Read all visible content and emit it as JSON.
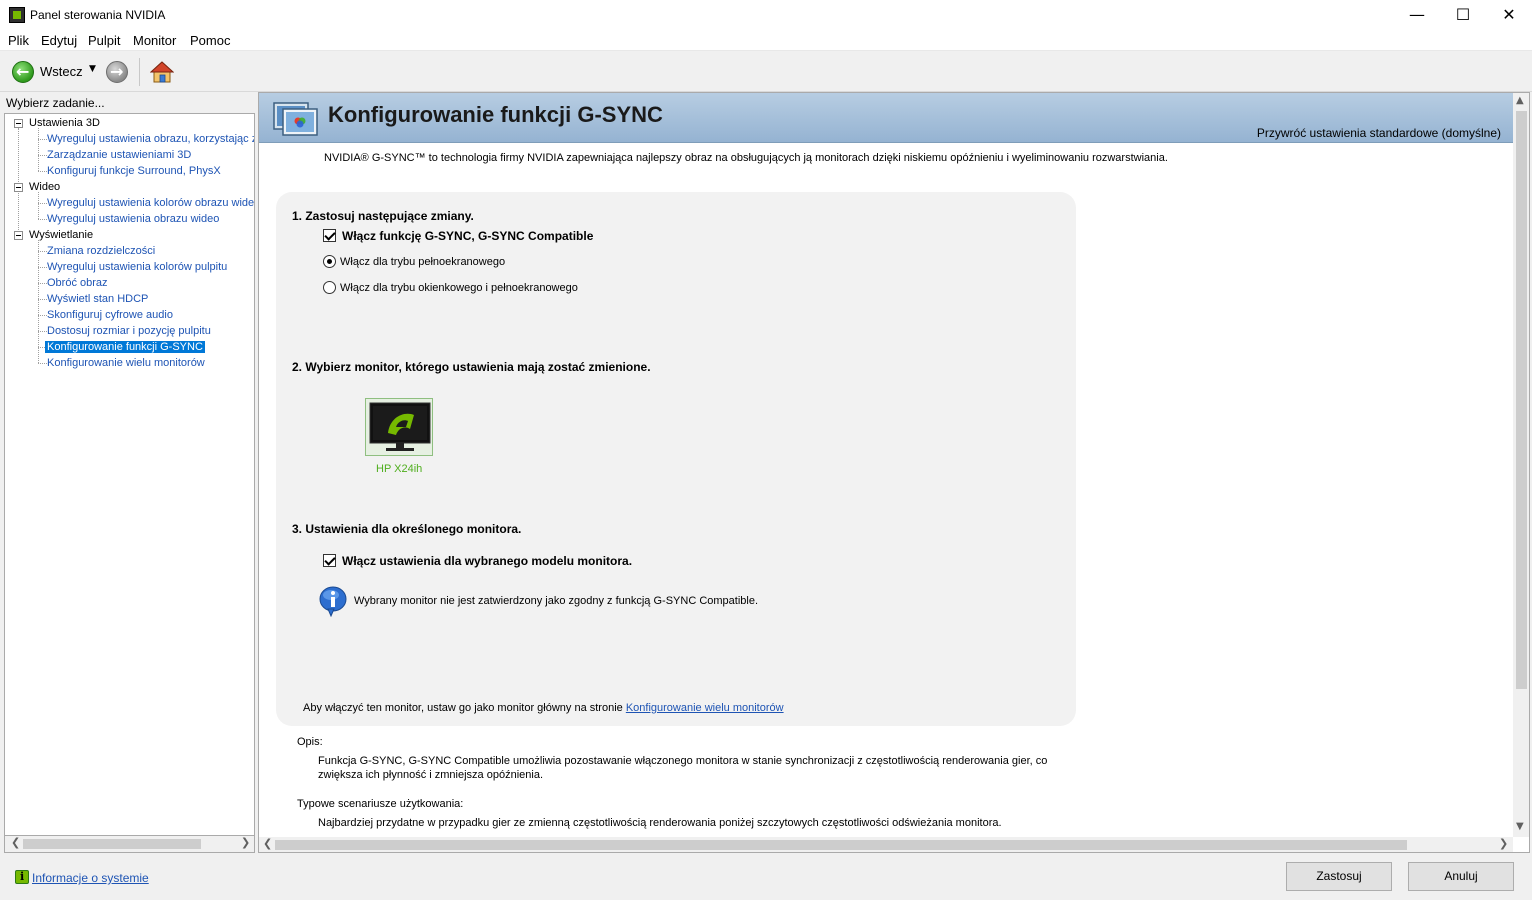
{
  "window": {
    "title": "Panel sterowania NVIDIA",
    "minimize": "—",
    "maximize": "☐",
    "close": "✕"
  },
  "menu": [
    "Plik",
    "Edytuj",
    "Pulpit",
    "Monitor",
    "Pomoc"
  ],
  "toolbar": {
    "back_label": "Wstecz",
    "dropdown_glyph": "▼"
  },
  "sidebar": {
    "task_label": "Wybierz zadanie...",
    "categories": [
      {
        "label": "Ustawienia 3D",
        "items": [
          "Wyreguluj ustawienia obrazu, korzystając z",
          "Zarządzanie ustawieniami 3D",
          "Konfiguruj funkcje Surround, PhysX"
        ]
      },
      {
        "label": "Wideo",
        "items": [
          "Wyreguluj ustawienia kolorów obrazu wideo",
          "Wyreguluj ustawienia obrazu wideo"
        ]
      },
      {
        "label": "Wyświetlanie",
        "items": [
          "Zmiana rozdzielczości",
          "Wyreguluj ustawienia kolorów pulpitu",
          "Obróć obraz",
          "Wyświetl stan HDCP",
          "Skonfiguruj cyfrowe audio",
          "Dostosuj rozmiar i pozycję pulpitu",
          "Konfigurowanie funkcji G-SYNC",
          "Konfigurowanie wielu monitorów"
        ]
      }
    ],
    "selected_item": "Konfigurowanie funkcji G-SYNC",
    "system_info_link": "Informacje o systemie"
  },
  "main": {
    "title": "Konfigurowanie funkcji G-SYNC",
    "restore_defaults": "Przywróć ustawienia standardowe (domyślne)",
    "intro": "NVIDIA® G-SYNC™ to technologia firmy NVIDIA zapewniająca najlepszy obraz na obsługujących ją monitorach dzięki niskiemu opóźnieniu i wyeliminowaniu rozwarstwiania.",
    "step1": {
      "heading": "1. Zastosuj następujące zmiany.",
      "enable_checkbox_label": "Włącz funkcję G-SYNC, G-SYNC Compatible",
      "enable_checked": true,
      "radio_fullscreen": "Włącz dla trybu pełnoekranowego",
      "radio_windowed": "Włącz dla trybu okienkowego i pełnoekranowego",
      "selected_mode": "fullscreen"
    },
    "step2": {
      "heading": "2. Wybierz monitor, którego ustawienia mają zostać zmienione.",
      "monitors": [
        {
          "name": "HP X24ih",
          "selected": true
        }
      ]
    },
    "step3": {
      "heading": "3. Ustawienia dla określonego monitora.",
      "model_checkbox_label": "Włącz ustawienia dla wybranego modelu monitora.",
      "model_checked": true,
      "info_text": "Wybrany monitor nie jest zatwierdzony jako zgodny z funkcją G-SYNC Compatible."
    },
    "footer_text": "Aby włączyć ten monitor, ustaw go jako monitor główny na stronie ",
    "footer_link": "Konfigurowanie wielu monitorów",
    "description_heading": "Opis:",
    "description_body": "Funkcja G-SYNC, G-SYNC Compatible umożliwia pozostawanie włączonego monitora w stanie synchronizacji z częstotliwością renderowania gier, co zwiększa ich płynność i zmniejsza opóźnienia.",
    "usage_heading": "Typowe scenariusze użytkowania:",
    "usage_body": "Najbardziej przydatne w przypadku gier ze zmienną częstotliwością renderowania poniżej szczytowych częstotliwości odświeżania monitora."
  },
  "buttons": {
    "apply": "Zastosuj",
    "cancel": "Anuluj"
  },
  "colors": {
    "link": "#1e54b4",
    "selection": "#0078d7",
    "nvidia_green": "#76b900",
    "header_blue": "#a6c0da"
  },
  "icons": {
    "app": "nvidia-app-icon",
    "back": "back-arrow-icon",
    "forward": "forward-arrow-icon",
    "home": "home-icon",
    "header": "monitor-settings-icon",
    "monitor": "nvidia-monitor-icon",
    "info": "info-icon",
    "system_info": "system-info-icon"
  }
}
